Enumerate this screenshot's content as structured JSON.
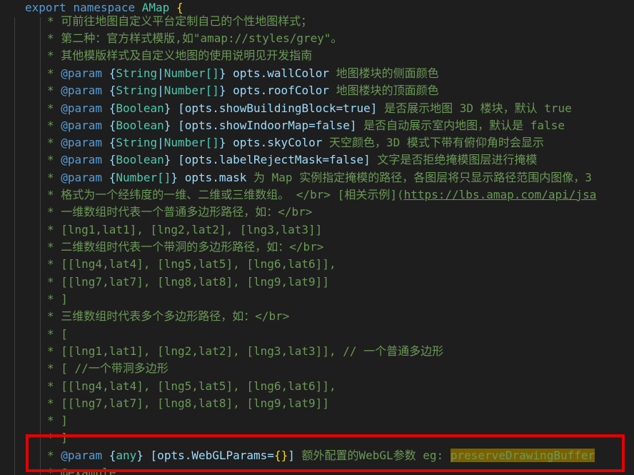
{
  "colors": {
    "background": "#1e1e1e",
    "comment": "#6a9955",
    "keyword": "#569cd6",
    "type": "#4ec9b0",
    "variable": "#9cdcfe",
    "bracket": "#ffd700",
    "selection_highlight": "#7a6100",
    "callout_border": "#e50000"
  },
  "header": {
    "kw_export": "export",
    "kw_namespace": "namespace",
    "ns_name": "AMap",
    "brace": "{"
  },
  "lines": [
    "* 可前往地图自定义平台定制自己的个性地图样式；",
    "* 第二种：官方样式模版,如\"amap://styles/grey\"。",
    "* 其他模版样式及自定义地图的使用说明见开发指南"
  ],
  "params": [
    {
      "tag": "@param",
      "lb": "{",
      "type1": "String",
      "pipe": "|",
      "type2": "Number[]",
      "rb": "}",
      "name": "opts.wallColor",
      "desc": "地图楼块的侧面颜色"
    },
    {
      "tag": "@param",
      "lb": "{",
      "type1": "String",
      "pipe": "|",
      "type2": "Number[]",
      "rb": "}",
      "name": "opts.roofColor",
      "desc": "地图楼块的顶面颜色"
    },
    {
      "tag": "@param",
      "lb": "{",
      "type1": "Boolean",
      "rb": "}",
      "name": "[opts.showBuildingBlock=true]",
      "desc": "是否展示地图 3D 楼块，默认 true"
    },
    {
      "tag": "@param",
      "lb": "{",
      "type1": "Boolean",
      "rb": "}",
      "name": "[opts.showIndoorMap=false]",
      "desc": "是否自动展示室内地图，默认是 false"
    },
    {
      "tag": "@param",
      "lb": "{",
      "type1": "String",
      "pipe": "|",
      "type2": "Number[]",
      "rb": "}",
      "name": "opts.skyColor",
      "desc": "天空颜色，3D 模式下带有俯仰角时会显示"
    },
    {
      "tag": "@param",
      "lb": "{",
      "type1": "Boolean",
      "rb": "}",
      "name": "[opts.labelRejectMask=false]",
      "desc": "文字是否拒绝掩模图层进行掩模"
    },
    {
      "tag": "@param",
      "lb": "{",
      "type1": "Number[]",
      "rb": "}",
      "name": "opts.mask",
      "desc": "为 Map 实例指定掩模的路径，各图层将只显示路径范围内图像，3"
    }
  ],
  "format_line": {
    "text": "* 格式为一个经纬度的一维、二维或三维数组。 </br> [相关示例](",
    "link": "https://lbs.amap.com/api/jsa"
  },
  "body_lines": [
    "* 一维数组时代表一个普通多边形路径，如：</br>",
    "* [lng1,lat1], [lng2,lat2], [lng3,lat3]]",
    "* 二维数组时代表一个带洞的多边形路径，如：</br>",
    "* [[lng4,lat4], [lng5,lat5], [lng6,lat6]],",
    "* [[lng7,lat7], [lng8,lat8], [lng9,lat9]]",
    "* ]",
    "* 三维数组时代表多个多边形路径，如：</br>",
    "* [",
    "* [[lng1,lat1], [lng2,lat2], [lng3,lat3]], // 一个普通多边形",
    "* [ //一个带洞多边形",
    "* [[lng4,lat4], [lng5,lat5], [lng6,lat6]],",
    "* [[lng7,lat7], [lng8,lat8], [lng9,lat9]]",
    "* ]",
    "* ]"
  ],
  "webgl_line": {
    "star": "*",
    "tag": "@param",
    "lb": "{",
    "type": "any",
    "rb": "}",
    "name_open": "[opts.WebGLParams=",
    "name_braces": "{}",
    "name_close": "]",
    "desc": "额外配置的WebGL参数 eg:",
    "highlighted": "preserveDrawingBuffer"
  },
  "last_line": "* @example"
}
